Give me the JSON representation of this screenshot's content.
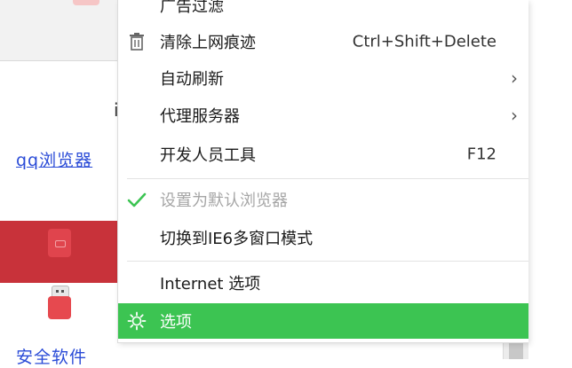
{
  "background": {
    "link_text": "qq浏览器",
    "link_text_2": "安全软件",
    "fragment_char": "i",
    "tile_label": "..."
  },
  "menu": {
    "items": [
      {
        "label": "广告过滤",
        "shortcut": "",
        "has_submenu": false,
        "icon": ""
      },
      {
        "label": "清除上网痕迹",
        "shortcut": "Ctrl+Shift+Delete",
        "has_submenu": false,
        "icon": "trash-icon"
      },
      {
        "label": "自动刷新",
        "shortcut": "",
        "has_submenu": true,
        "icon": ""
      },
      {
        "label": "代理服务器",
        "shortcut": "",
        "has_submenu": true,
        "icon": ""
      },
      {
        "label": "开发人员工具",
        "shortcut": "F12",
        "has_submenu": false,
        "icon": ""
      },
      {
        "label": "设置为默认浏览器",
        "shortcut": "",
        "has_submenu": false,
        "icon": "checkmark-icon",
        "disabled": true
      },
      {
        "label": "切换到IE6多窗口模式",
        "shortcut": "",
        "has_submenu": false,
        "icon": ""
      },
      {
        "label": "Internet 选项",
        "shortcut": "",
        "has_submenu": false,
        "icon": ""
      },
      {
        "label": "选项",
        "shortcut": "",
        "has_submenu": false,
        "icon": "gear-icon",
        "selected": true
      }
    ],
    "submenu_arrow": "›"
  },
  "colors": {
    "selected_bg": "#3cc452",
    "check_green": "#3cc452",
    "disabled_text": "#a6a6a6"
  }
}
